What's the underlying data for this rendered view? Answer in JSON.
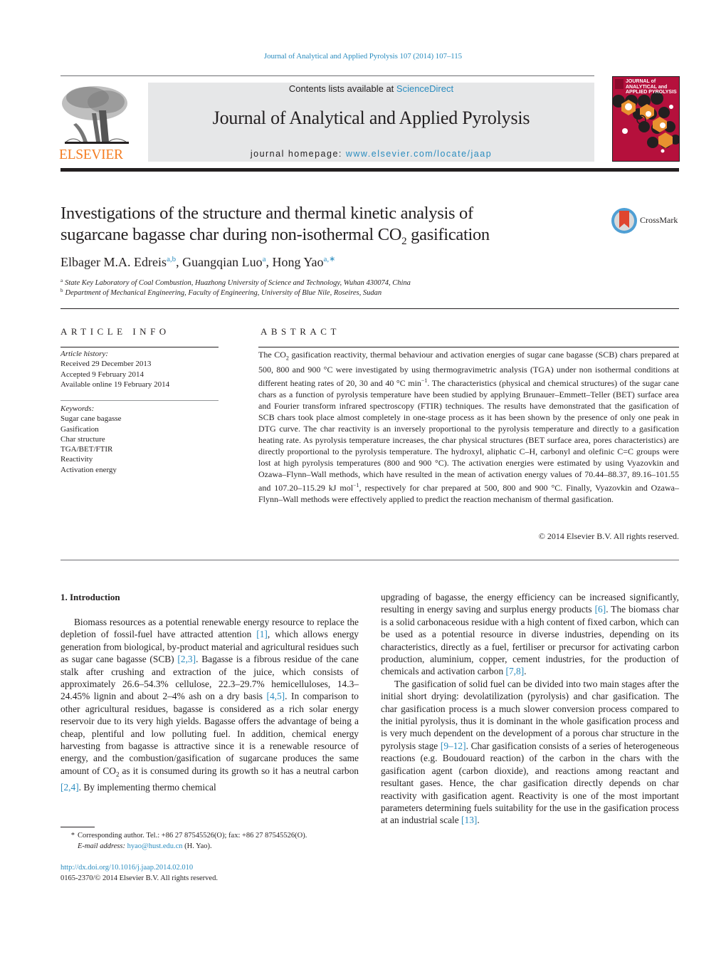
{
  "header": {
    "running_head": "Journal of Analytical and Applied Pyrolysis 107 (2014) 107–115",
    "contents_prefix": "Contents lists available at ",
    "contents_link": "ScienceDirect",
    "journal_title": "Journal of Analytical and Applied Pyrolysis",
    "homepage_prefix": "journal homepage: ",
    "homepage_link": "www.elsevier.com/locate/jaap",
    "publisher_logo_text": "ELSEVIER",
    "cover_lines": [
      "JOURNAL of",
      "ANALYTICAL and",
      "APPLIED PYROLYSIS"
    ],
    "crossmark_label": "CrossMark",
    "colors": {
      "link_blue": "#2a8cbf",
      "elsevier_orange": "#f47c20",
      "masthead_gray": "#e6e7e8",
      "cover_red": "#b5103c",
      "cover_orange": "#e8912f"
    }
  },
  "article": {
    "title_line1": "Investigations of the structure and thermal kinetic analysis of",
    "title_line2_pre": "sugarcane bagasse char during non-isothermal CO",
    "title_line2_sub": "2",
    "title_line2_post": " gasification",
    "authors": [
      {
        "name": "Elbager M.A. Edreis",
        "sup": "a,b",
        "sep": ", "
      },
      {
        "name": "Guangqian Luo",
        "sup": "a",
        "sep": ", "
      },
      {
        "name": "Hong Yao",
        "sup": "a,∗",
        "sep": ""
      }
    ],
    "affiliations": [
      {
        "mark": "a",
        "text": "State Key Laboratory of Coal Combustion, Huazhong University of Science and Technology, Wuhan 430074, China"
      },
      {
        "mark": "b",
        "text": "Department of Mechanical Engineering, Faculty of Engineering, University of Blue Nile, Roseires, Sudan"
      }
    ]
  },
  "article_info": {
    "heading": "ARTICLE INFO",
    "history_label": "Article history:",
    "history": [
      "Received 29 December 2013",
      "Accepted 9 February 2014",
      "Available online 19 February 2014"
    ],
    "keywords_label": "Keywords:",
    "keywords": [
      "Sugar cane bagasse",
      "Gasification",
      "Char structure",
      "TGA/BET/FTIR",
      "Reactivity",
      "Activation energy"
    ]
  },
  "abstract": {
    "heading": "ABSTRACT",
    "text_pre": "The CO",
    "text_sub": "2",
    "text_mid": " gasification reactivity, thermal behaviour and activation energies of sugar cane bagasse (SCB) chars prepared at 500, 800 and 900 °C were investigated by using thermogravimetric analysis (TGA) under non isothermal conditions at different heating rates of 20, 30 and 40 °C min",
    "text_sup1": "−1",
    "text_mid2": ". The characteristics (physical and chemical structures) of the sugar cane chars as a function of pyrolysis temperature have been studied by applying Brunauer–Emmett–Teller (BET) surface area and Fourier transform infrared spectroscopy (FTIR) techniques. The results have demonstrated that the gasification of SCB chars took place almost completely in one-stage process as it has been shown by the presence of only one peak in DTG curve. The char reactivity is an inversely proportional to the pyrolysis temperature and directly to a gasification heating rate. As pyrolysis temperature increases, the char physical structures (BET surface area, pores characteristics) are directly proportional to the pyrolysis temperature. The hydroxyl, aliphatic C–H, carbonyl and olefinic C=C groups were lost at high pyrolysis temperatures (800 and 900 °C). The activation energies were estimated by using Vyazovkin and Ozawa–Flynn–Wall methods, which have resulted in the mean of activation energy values of 70.44–88.37, 89.16–101.55 and 107.20–115.29 kJ mol",
    "text_sup2": "−1",
    "text_end": ", respectively for char prepared at 500, 800 and 900 °C. Finally, Vyazovkin and Ozawa–Flynn–Wall methods were effectively applied to predict the reaction mechanism of thermal gasification.",
    "copyright": "© 2014 Elsevier B.V. All rights reserved."
  },
  "introduction": {
    "heading": "1.  Introduction",
    "left": {
      "p1_a": "Biomass resources as a potential renewable energy resource to replace the depletion of fossil-fuel have attracted attention ",
      "ref1": "[1]",
      "p1_b": ", which allows energy generation from biological, by-product material and agricultural residues such as sugar cane bagasse (SCB) ",
      "ref2": "[2,3]",
      "p1_c": ". Bagasse is a fibrous residue of the cane stalk after crushing and extraction of the juice, which consists of approximately 26.6–54.3% cellulose, 22.3–29.7% hemicelluloses, 14.3–24.45% lignin and about 2–4% ash on a dry basis ",
      "ref3": "[4,5]",
      "p1_d": ". In comparison to other agricultural residues, bagasse is considered as a rich solar energy reservoir due to its very high yields. Bagasse offers the advantage of being a cheap, plentiful and low polluting fuel. In addition, chemical energy harvesting from bagasse is attractive since it is a renewable resource of energy, and the combustion/gasification of sugarcane produces the same amount of CO",
      "sub": "2",
      "p1_e": " as it is consumed during its growth so it has a neutral carbon ",
      "ref4": "[2,4]",
      "p1_f": ". By implementing thermo chemical"
    },
    "right": {
      "p1_a": "upgrading of bagasse, the energy efficiency can be increased significantly, resulting in energy saving and surplus energy products ",
      "ref1": "[6]",
      "p1_b": ". The biomass char is a solid carbonaceous residue with a high content of fixed carbon, which can be used as a potential resource in diverse industries, depending on its characteristics, directly as a fuel, fertiliser or precursor for activating carbon production, aluminium, copper, cement industries, for the production of chemicals and activation carbon ",
      "ref2": "[7,8]",
      "p1_c": ".",
      "p2_a": "The gasification of solid fuel can be divided into two main stages after the initial short drying: devolatilization (pyrolysis) and char gasification. The char gasification process is a much slower conversion process compared to the initial pyrolysis, thus it is dominant in the whole gasification process and is very much dependent on the development of a porous char structure in the pyrolysis stage ",
      "ref3": "[9–12]",
      "p2_b": ". Char gasification consists of a series of heterogeneous reactions (e.g. Boudouard reaction) of the carbon in the chars with the gasification agent (carbon dioxide), and reactions among reactant and resultant gases. Hence, the char gasification directly depends on char reactivity with gasification agent. Reactivity is one of the most important parameters determining fuels suitability for the use in the gasification process at an industrial scale ",
      "ref4": "[13]",
      "p2_c": "."
    }
  },
  "footnote": {
    "star": "*",
    "corresponding": "Corresponding author. Tel.: +86 27 87545526(O); fax: +86 27 87545526(O).",
    "email_label": "E-mail address: ",
    "email": "hyao@hust.edu.cn",
    "email_suffix": " (H. Yao).",
    "doi": "http://dx.doi.org/10.1016/j.jaap.2014.02.010",
    "issn": "0165-2370/© 2014 Elsevier B.V. All rights reserved."
  }
}
